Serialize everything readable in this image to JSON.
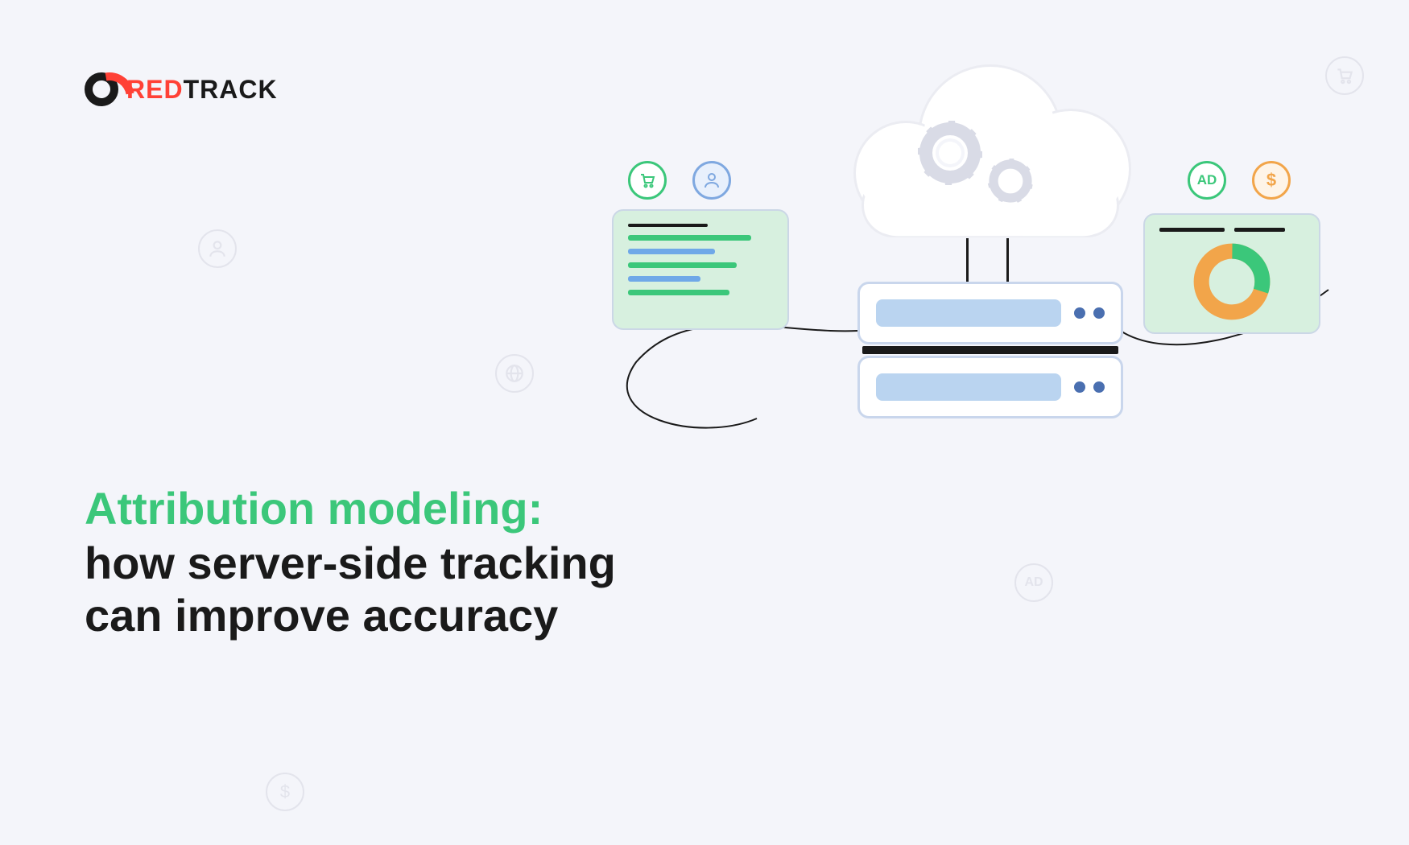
{
  "brand": {
    "red": "RED",
    "track": "TRACK"
  },
  "headline": {
    "line1": "Attribution modeling:",
    "line2": "how server-side tracking",
    "line3": "can improve accuracy"
  },
  "badges": {
    "ad": "AD",
    "dollar": "$"
  },
  "ghost": {
    "ad": "AD",
    "dollar": "$"
  },
  "colors": {
    "accent_green": "#3BC77A",
    "accent_red": "#ff4136",
    "panel_green": "#D7F0DF",
    "bar_blue": "#BAD4F0",
    "donut_orange": "#F2A54A"
  }
}
